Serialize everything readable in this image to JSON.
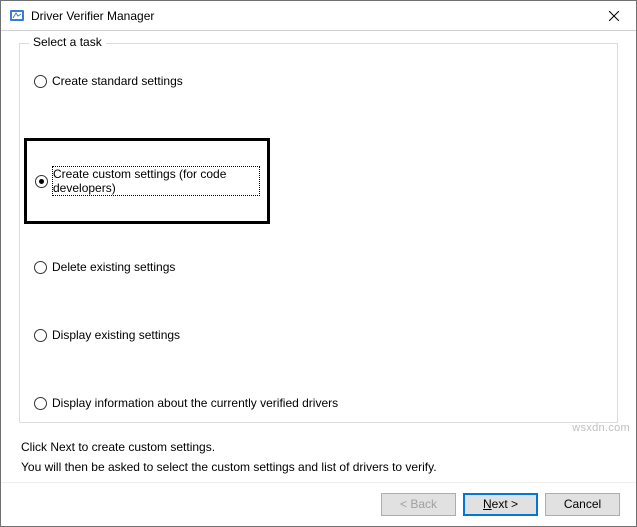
{
  "window": {
    "title": "Driver Verifier Manager"
  },
  "group": {
    "label": "Select a task"
  },
  "options": {
    "create_standard": "Create standard settings",
    "create_custom": "Create custom settings (for code developers)",
    "delete_existing": "Delete existing settings",
    "display_existing": "Display existing settings",
    "display_info": "Display information about the currently verified drivers"
  },
  "info": {
    "line1": "Click Next to create custom settings.",
    "line2": "You will then be asked to select the custom settings and list of drivers to verify."
  },
  "buttons": {
    "back": "< Back",
    "next": "Next >",
    "cancel": "Cancel"
  },
  "watermark": "wsxdn.com"
}
